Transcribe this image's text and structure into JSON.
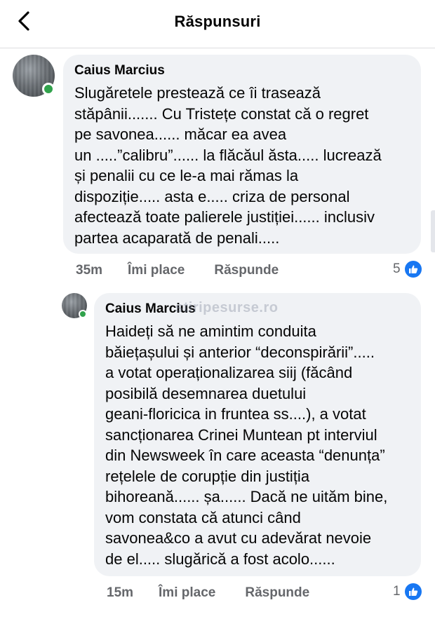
{
  "header": {
    "title": "Răspunsuri"
  },
  "watermark": "stiripesurse.ro",
  "comments": [
    {
      "author": "Caius Marcius",
      "text": "Slugăretele prestează ce îi trasează\nstăpânii....... Cu Tristețe constat că o regret\npe savonea...... măcar ea avea\nun .....”calibru”...... la flăcăul ăsta..... lucrează\nși penalii cu ce le-a mai rămas la\ndispoziție..... asta e..... criza de personal\nafectează toate palierele justiției...... inclusiv\npartea acaparată de penali.....",
      "time": "35m",
      "like_label": "Îmi place",
      "reply_label": "Răspunde",
      "reaction_count": "5",
      "online": true
    },
    {
      "author": "Caius Marcius",
      "text": "Haideți să ne amintim conduita\nbăiețașului și anterior “deconspirării”.....\na votat operaționalizarea siij (făcând\nposibilă desemnarea duetului\ngeani-floricica in fruntea ss....), a votat\nsancționarea Crinei Muntean pt interviul\ndin Newsweek în care aceasta “denunța”\nrețelele de corupție din justiția\nbihoreană...... șa...... Dacă ne uităm bine,\nvom constata că atunci când\nsavonea&co a avut cu adevărat nevoie\nde el..... slugărică a fost acolo......",
      "time": "15m",
      "like_label": "Îmi place",
      "reply_label": "Răspunde",
      "reaction_count": "1",
      "online": true
    }
  ],
  "colors": {
    "accent": "#1877f2",
    "online": "#31a24c",
    "bubble": "#f0f2f5",
    "meta": "#65676b"
  }
}
